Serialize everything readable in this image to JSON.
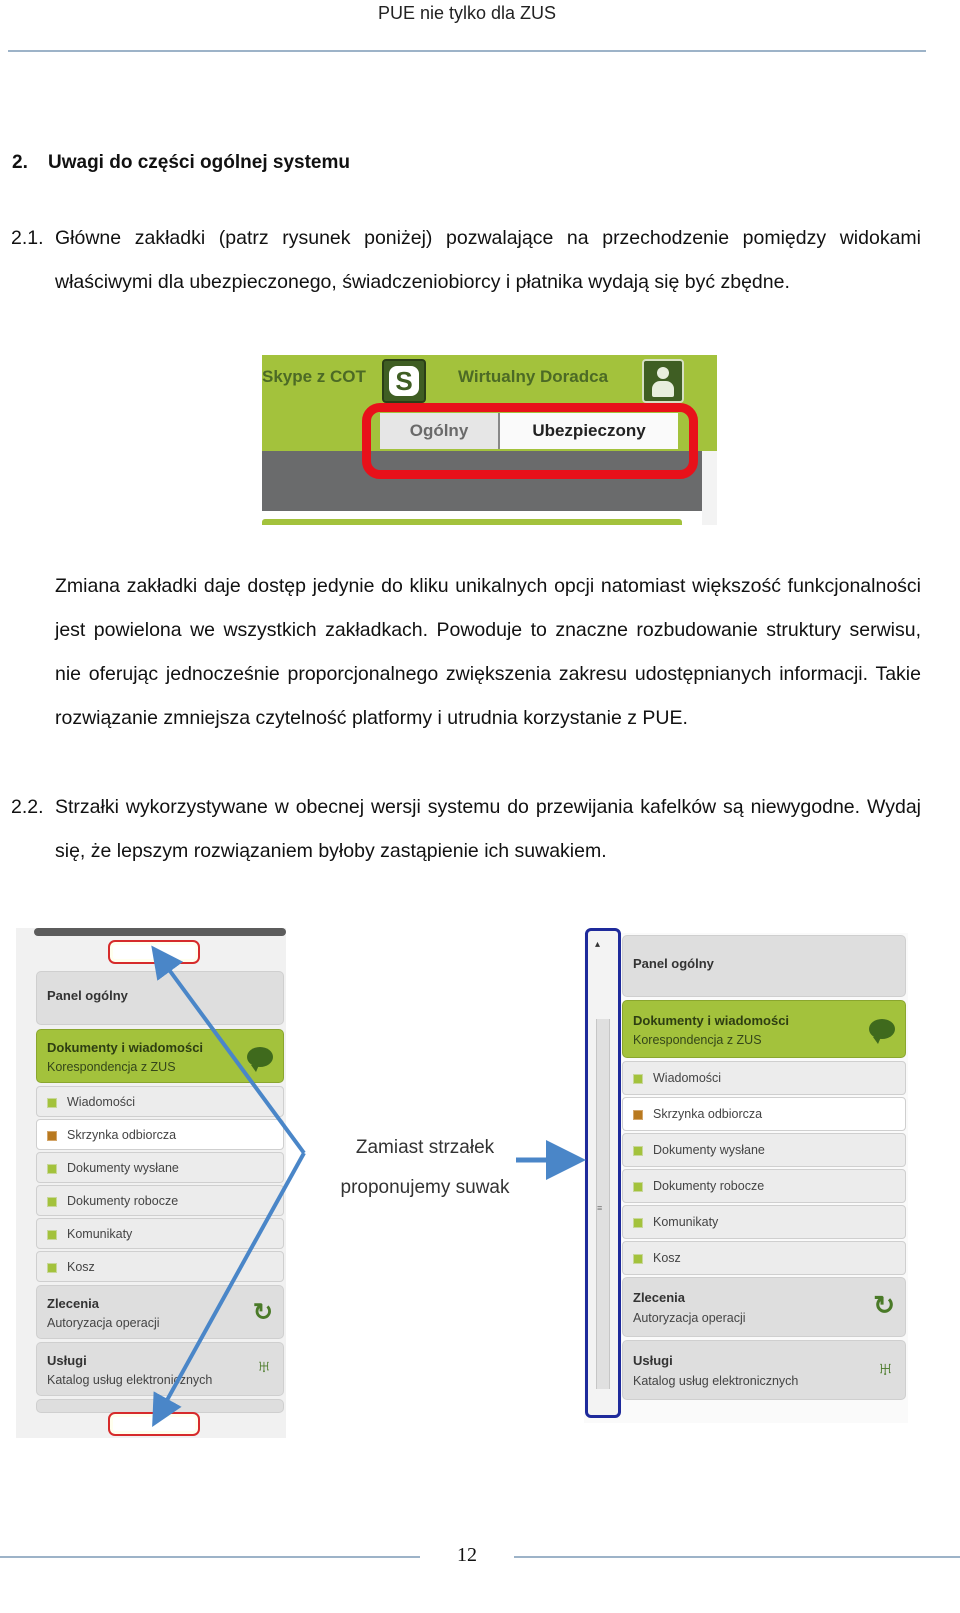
{
  "header": {
    "title": "PUE nie tylko dla ZUS"
  },
  "section": {
    "number": "2.",
    "title": "Uwagi do części ogólnej systemu"
  },
  "paragraphs": {
    "p1_number": "2.1.",
    "p1_text": "Główne zakładki (patrz rysunek poniżej) pozwalające na przechodzenie pomiędzy widokami właściwymi dla ubezpieczonego, świadczeniobiorcy i płatnika wydają się być zbędne.",
    "p2_text": "Zmiana zakładki daje dostęp jedynie do kliku unikalnych opcji natomiast większość funkcjonalności jest powielona we wszystkich zakładkach. Powoduje to znaczne rozbudowanie struktury serwisu, nie oferując jednocześnie proporcjonalnego zwiększenia zakresu udostępnianych informacji. Takie rozwiązanie zmniejsza czytelność platformy i utrudnia korzystanie z PUE.",
    "p3_number": "2.2.",
    "p3_text": "Strzałki wykorzystywane w obecnej wersji systemu do przewijania kafelków są niewygodne.  Wydaj się, że lepszym rozwiązaniem byłoby zastąpienie ich suwakiem."
  },
  "figure1": {
    "skype_label": "Skype z COT",
    "skype_icon": "skype-icon",
    "advisor_label": "Wirtualny Doradca",
    "advisor_icon": "person-icon",
    "tabs": [
      {
        "label": "Ogólny",
        "active": false
      },
      {
        "label": "Ubezpieczony",
        "active": true
      }
    ],
    "highlight_color": "#e8111a",
    "accent_color": "#a3c23c"
  },
  "figure2": {
    "annotation_line1": "Zamiast strzałek",
    "annotation_line2": "proponujemy suwak",
    "panel": {
      "general": "Panel ogólny",
      "documents_title": "Dokumenty i wiadomości",
      "documents_subtitle": "Korespondencja z ZUS",
      "documents_icon": "speech-bubble-icon",
      "sub_items": [
        {
          "label": "Wiadomości",
          "active": false
        },
        {
          "label": "Skrzynka odbiorcza",
          "active": true
        },
        {
          "label": "Dokumenty wysłane",
          "active": false
        },
        {
          "label": "Dokumenty robocze",
          "active": false
        },
        {
          "label": "Komunikaty",
          "active": false
        },
        {
          "label": "Kosz",
          "active": false
        }
      ],
      "orders_title": "Zlecenia",
      "orders_subtitle": "Autoryzacja operacji",
      "orders_icon": "refresh-icon",
      "services_title": "Usługi",
      "services_subtitle": "Katalog usług elektronicznych",
      "services_icon": "services-icon"
    },
    "arrow_color": "#4a86c8",
    "scrollbar_highlight_color": "#1e2a9b"
  },
  "footer": {
    "page_number": "12"
  }
}
